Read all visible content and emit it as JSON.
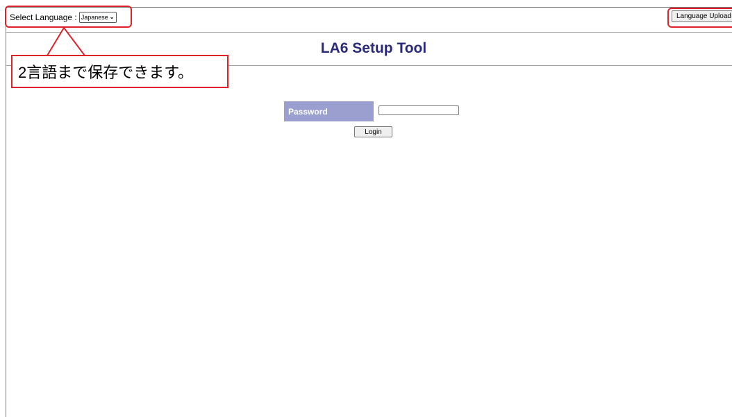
{
  "header": {
    "select_language_label": "Select Language :",
    "language_selected": "Japanese",
    "language_upload_label": "Language Upload"
  },
  "title": "LA6 Setup Tool",
  "callout": {
    "text": "2言語まで保存できます。"
  },
  "login": {
    "password_label": "Password",
    "password_value": "",
    "login_label": "Login"
  },
  "colors": {
    "title": "#2a2a7a",
    "password_label_bg": "#9b9fcf",
    "annotation_red": "#e0202a"
  }
}
